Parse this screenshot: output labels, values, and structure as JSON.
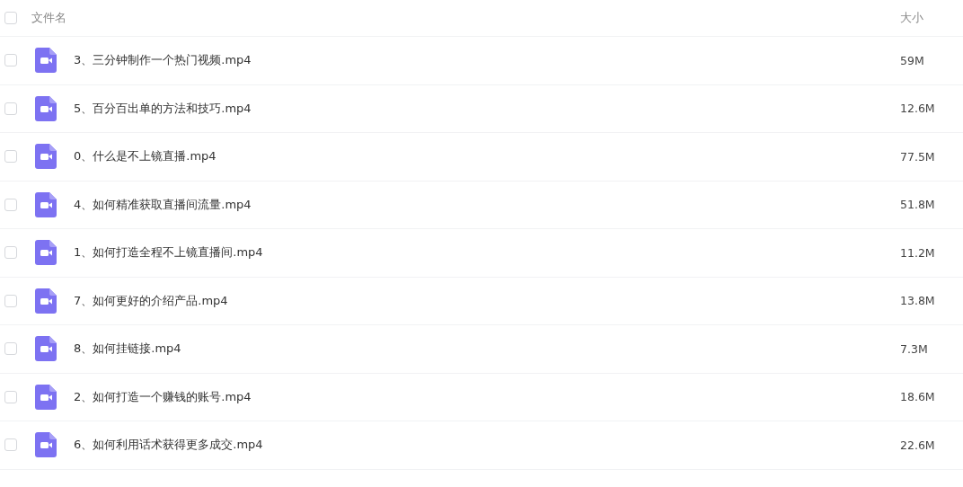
{
  "header": {
    "checked": false,
    "name_label": "文件名",
    "size_label": "大小"
  },
  "files": [
    {
      "name": "3、三分钟制作一个热门视频.mp4",
      "size": "59M",
      "checked": false,
      "kind": "video"
    },
    {
      "name": "5、百分百出单的方法和技巧.mp4",
      "size": "12.6M",
      "checked": false,
      "kind": "video"
    },
    {
      "name": "0、什么是不上镜直播.mp4",
      "size": "77.5M",
      "checked": false,
      "kind": "video"
    },
    {
      "name": "4、如何精准获取直播间流量.mp4",
      "size": "51.8M",
      "checked": false,
      "kind": "video"
    },
    {
      "name": "1、如何打造全程不上镜直播间.mp4",
      "size": "11.2M",
      "checked": false,
      "kind": "video"
    },
    {
      "name": "7、如何更好的介绍产品.mp4",
      "size": "13.8M",
      "checked": false,
      "kind": "video"
    },
    {
      "name": "8、如何挂链接.mp4",
      "size": "7.3M",
      "checked": false,
      "kind": "video"
    },
    {
      "name": "2、如何打造一个赚钱的账号.mp4",
      "size": "18.6M",
      "checked": false,
      "kind": "video"
    },
    {
      "name": "6、如何利用话术获得更多成交.mp4",
      "size": "22.6M",
      "checked": false,
      "kind": "video"
    }
  ]
}
